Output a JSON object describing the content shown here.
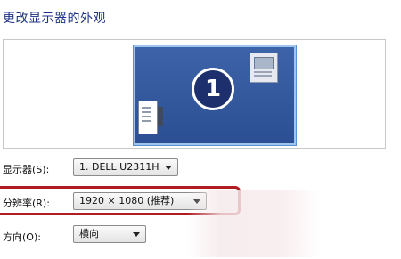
{
  "title": "更改显示器的外观",
  "preview": {
    "selected_monitor_number": "1",
    "icons": {
      "main": "primary-monitor-icon",
      "secondary_right": "secondary-monitor-icon",
      "secondary_left": "secondary-monitor-icon"
    }
  },
  "fields": {
    "display": {
      "label": "显示器(S):",
      "value": "1. DELL U2311H"
    },
    "resolution": {
      "label": "分辨率(R):",
      "value": "1920 × 1080 (推荐)"
    },
    "orientation": {
      "label": "方向(O):",
      "value": "横向"
    }
  },
  "colors": {
    "title": "#1e3287",
    "highlight": "#b01c22",
    "monitor": "#2c4f93"
  }
}
